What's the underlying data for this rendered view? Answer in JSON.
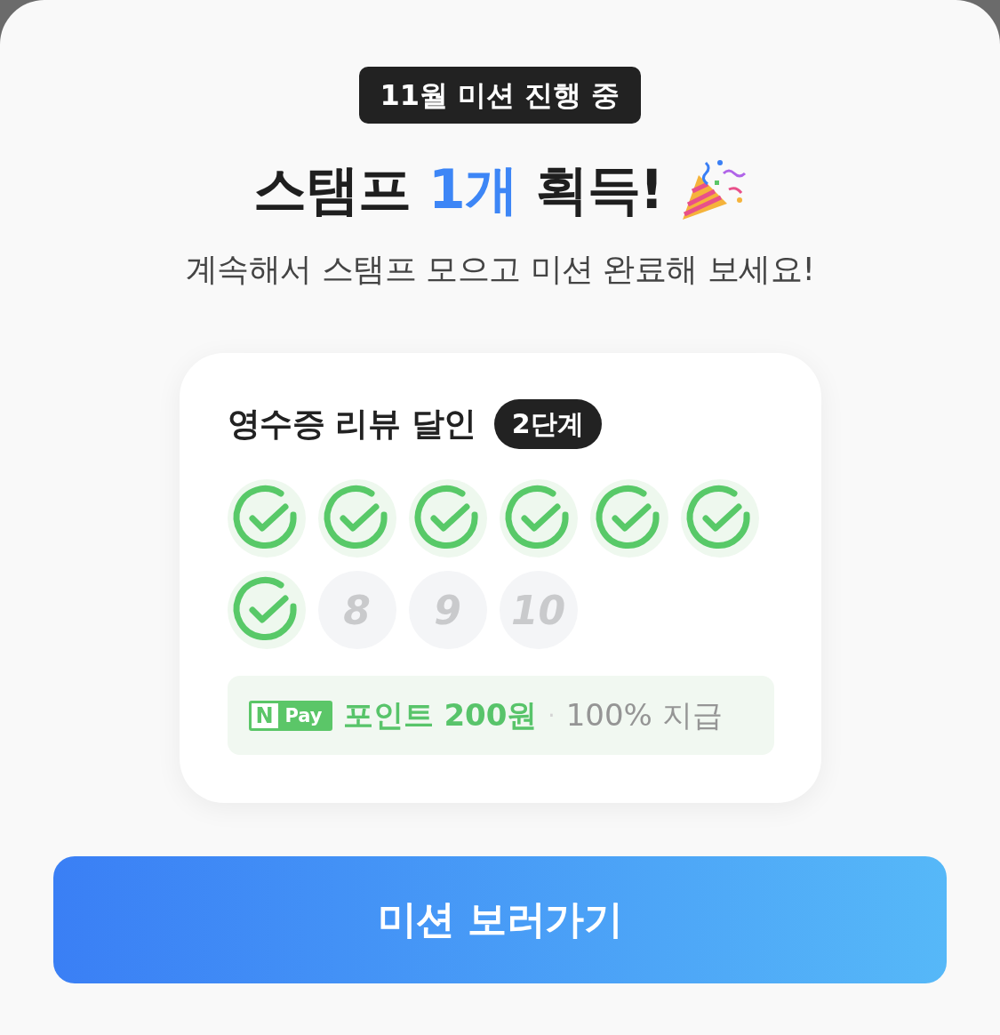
{
  "sheet": {
    "badge": "11월 미션 진행 중",
    "title": {
      "before": "스탬프",
      "highlight": "1개",
      "after": "획득!"
    },
    "subtitle": "계속해서 스탬프 모으고 미션 완료해 보세요!"
  },
  "mission_card": {
    "title": "영수증 리뷰 달인",
    "level_badge": "2단계",
    "stamps": [
      {
        "checked": true
      },
      {
        "checked": true
      },
      {
        "checked": true
      },
      {
        "checked": true
      },
      {
        "checked": true
      },
      {
        "checked": true
      },
      {
        "checked": true
      },
      {
        "checked": false,
        "label": "8"
      },
      {
        "checked": false,
        "label": "9"
      },
      {
        "checked": false,
        "label": "10"
      }
    ],
    "reward": {
      "logo_mark": "N",
      "logo_text": "Pay",
      "points": "포인트 200원",
      "separator": "·",
      "rate": "100% 지급"
    }
  },
  "button": "미션 보러가기"
}
